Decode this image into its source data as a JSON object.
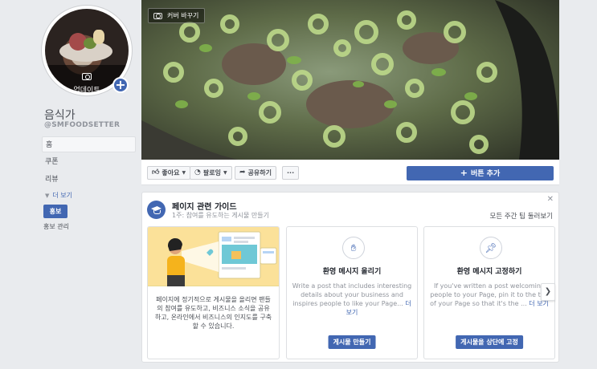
{
  "profile": {
    "update_label": "업데이트",
    "page_name": "음식가",
    "handle": "@SMFOODSETTER"
  },
  "nav": {
    "items": [
      {
        "label": "홈",
        "active": true
      },
      {
        "label": "쿠폰"
      },
      {
        "label": "리뷰"
      }
    ],
    "more_label": "더 보기",
    "promote_label": "홍보",
    "promote_manage_label": "홍보 관리"
  },
  "cover": {
    "change_cover_label": "커버 바꾸기"
  },
  "actions": {
    "like_label": "좋아요",
    "follow_label": "팔로잉",
    "share_label": "공유하기",
    "more_label": "···",
    "add_button_label": "버튼 추가"
  },
  "guide": {
    "title": "페이지 관련 가이드",
    "subtitle": "1주: 참여를 유도하는 게시물 만들기",
    "see_all_label": "모든 주간 팁 둘러보기",
    "intro_text": "페이지에 정기적으로 게시물을 올리면 팬들의 참여를 유도하고, 비즈니스 소식을 공유하고, 온라인에서 비즈니스의 인지도를 구축할 수 있습니다.",
    "cards": [
      {
        "title": "환영 메시지 올리기",
        "desc": "Write a post that includes interesting details about your business and inspires people to like your Page...",
        "more": "더 보기",
        "button": "게시물 만들기"
      },
      {
        "title": "환영 메시지 고정하기",
        "desc": "If you've written a post welcoming people to your Page, pin it to the top of your Page so that it's the ...",
        "more": "더 보기",
        "button": "게시물을 상단에 고정"
      }
    ]
  },
  "colors": {
    "accent": "#4267b2",
    "background": "#e9ebee",
    "illustration_bg": "#fbe199"
  }
}
